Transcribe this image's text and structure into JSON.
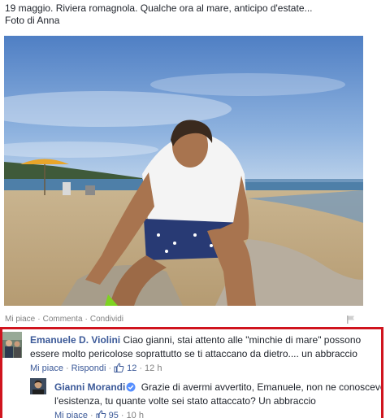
{
  "post": {
    "caption_line1": "19 maggio. Riviera romagnola. Qualche ora al mare, anticipo d'estate...",
    "caption_line2": "Foto di Anna"
  },
  "actions": {
    "like": "Mi piace",
    "comment": "Commenta",
    "share": "Condividi",
    "separator": "·"
  },
  "comments": [
    {
      "author": "Emanuele D. Violini",
      "text": "Ciao gianni, stai attento alle \"minchie di mare\" possono essere molto pericolose soprattutto se ti attaccano da dietro.... un abbraccio",
      "like_label": "Mi piace",
      "reply_label": "Rispondi",
      "likes": "12",
      "time": "12 h"
    },
    {
      "author": "Gianni Morandi",
      "verified": true,
      "text": "Grazie di avermi avvertito, Emanuele, non ne conoscevo l'esistenza, tu quante volte sei stato attaccato? Un abbraccio",
      "like_label": "Mi piace",
      "likes": "95",
      "time": "10 h"
    }
  ],
  "colors": {
    "link": "#3b5998",
    "highlight_border": "#d0141e",
    "meta": "#7f7f7f",
    "sky": "#7aa3d6",
    "sea": "#4e7fa8",
    "sand": "#cdb58c"
  },
  "icons": [
    "flag-icon",
    "verified-icon",
    "thumbs-up-icon"
  ]
}
